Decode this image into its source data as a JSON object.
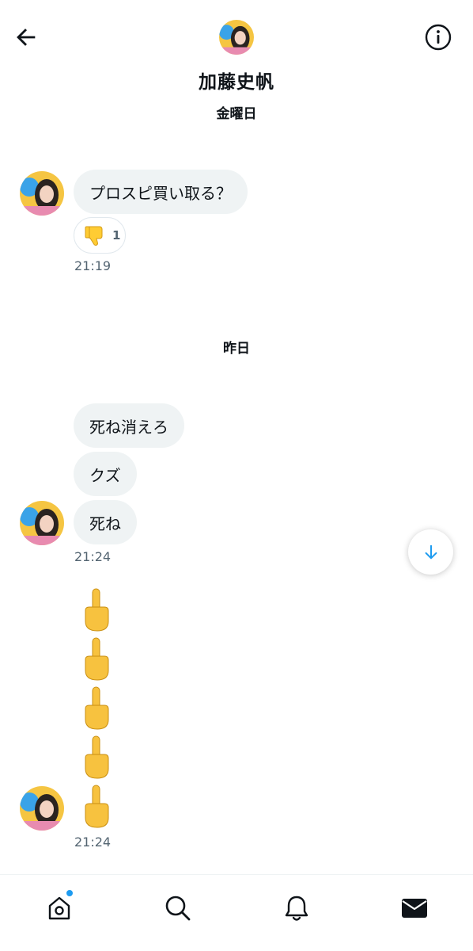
{
  "header": {
    "contact_name": "加藤史帆",
    "avatar_icon": "avatar-photo",
    "back_icon": "back-arrow-icon",
    "info_icon": "info-icon"
  },
  "messages": {
    "friday": {
      "date_label": "金曜日",
      "bubble_text": "プロスピ買い取る？",
      "reaction_emoji": "thumbs-down",
      "reaction_count": "1",
      "time": "21:19"
    },
    "yesterday": {
      "date_label": "昨日",
      "bubbles": [
        "死ね消えろ",
        "クズ",
        "死ね"
      ],
      "time": "21:24",
      "emoji_messages": [
        "middle-finger",
        "middle-finger",
        "middle-finger",
        "middle-finger",
        "middle-finger"
      ],
      "emoji_time": "21:24"
    }
  },
  "scroll_button": {
    "icon": "arrow-down-icon",
    "color": "#1d9bf0"
  },
  "bottom_nav": {
    "items": [
      "home",
      "search",
      "notifications",
      "messages"
    ],
    "active": "messages",
    "home_has_badge": true,
    "badge_color": "#1d9bf0"
  },
  "colors": {
    "bubble_bg": "#eff3f4",
    "text": "#0f1419",
    "secondary_text": "#536471"
  }
}
